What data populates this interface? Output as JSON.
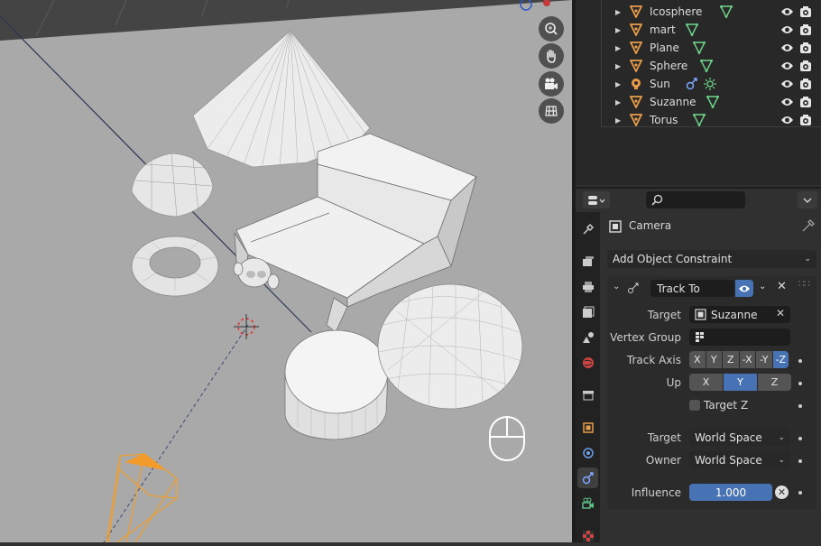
{
  "outliner": {
    "items": [
      {
        "name": "Icosphere",
        "type": "mesh"
      },
      {
        "name": "mart",
        "type": "mesh"
      },
      {
        "name": "Plane",
        "type": "mesh"
      },
      {
        "name": "Sphere",
        "type": "mesh"
      },
      {
        "name": "Sun",
        "type": "light"
      },
      {
        "name": "Suzanne",
        "type": "mesh"
      },
      {
        "name": "Torus",
        "type": "mesh"
      }
    ]
  },
  "properties": {
    "object_name": "Camera",
    "add_constraint_label": "Add Object Constraint",
    "constraint": {
      "name": "Track To",
      "target_label": "Target",
      "target_value": "Suzanne",
      "vertex_group_label": "Vertex Group",
      "vertex_group_value": "",
      "track_axis_label": "Track Axis",
      "track_axis_options": [
        "X",
        "Y",
        "Z",
        "-X",
        "-Y",
        "-Z"
      ],
      "track_axis_selected": "-Z",
      "up_label": "Up",
      "up_options": [
        "X",
        "Y",
        "Z"
      ],
      "up_selected": "Y",
      "target_z_label": "Target Z",
      "target_z_checked": false,
      "target_space_label": "Target",
      "target_space_value": "World Space",
      "owner_space_label": "Owner",
      "owner_space_value": "World Space",
      "influence_label": "Influence",
      "influence_value": "1.000"
    }
  },
  "colors": {
    "accent": "#4772b3",
    "object_orange": "#e89c4a",
    "mesh_green": "#6fd48b",
    "viewport_bg": "#a9a9a9"
  },
  "icons": [
    "zoom-icon",
    "hand-pan-icon",
    "camera-view-icon",
    "grid-ortho-icon",
    "eye-icon",
    "camera-render-icon",
    "mouse-icon"
  ]
}
